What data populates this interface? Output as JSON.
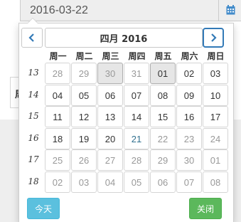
{
  "date_field": {
    "value": "2016-03-22"
  },
  "background": {
    "fragment_text": "周"
  },
  "picker": {
    "title": "四月 2016",
    "weekdays": [
      "周一",
      "周二",
      "周三",
      "周四",
      "周五",
      "周六",
      "周日"
    ],
    "weeks": [
      {
        "num": "13",
        "days": [
          {
            "t": "28",
            "s": "muted"
          },
          {
            "t": "29",
            "s": "muted"
          },
          {
            "t": "30",
            "s": "muted-sel"
          },
          {
            "t": "31",
            "s": "muted"
          },
          {
            "t": "01",
            "s": "sel"
          },
          {
            "t": "02",
            "s": ""
          },
          {
            "t": "03",
            "s": ""
          }
        ]
      },
      {
        "num": "14",
        "days": [
          {
            "t": "04",
            "s": ""
          },
          {
            "t": "05",
            "s": ""
          },
          {
            "t": "06",
            "s": ""
          },
          {
            "t": "07",
            "s": ""
          },
          {
            "t": "08",
            "s": ""
          },
          {
            "t": "09",
            "s": ""
          },
          {
            "t": "10",
            "s": ""
          }
        ]
      },
      {
        "num": "15",
        "days": [
          {
            "t": "11",
            "s": ""
          },
          {
            "t": "12",
            "s": ""
          },
          {
            "t": "13",
            "s": ""
          },
          {
            "t": "14",
            "s": ""
          },
          {
            "t": "15",
            "s": ""
          },
          {
            "t": "16",
            "s": ""
          },
          {
            "t": "17",
            "s": ""
          }
        ]
      },
      {
        "num": "16",
        "days": [
          {
            "t": "18",
            "s": ""
          },
          {
            "t": "19",
            "s": ""
          },
          {
            "t": "20",
            "s": ""
          },
          {
            "t": "21",
            "s": "info"
          },
          {
            "t": "22",
            "s": "muted"
          },
          {
            "t": "23",
            "s": "muted"
          },
          {
            "t": "24",
            "s": "muted"
          }
        ]
      },
      {
        "num": "17",
        "days": [
          {
            "t": "25",
            "s": "muted"
          },
          {
            "t": "26",
            "s": "muted"
          },
          {
            "t": "27",
            "s": "muted"
          },
          {
            "t": "28",
            "s": "muted"
          },
          {
            "t": "29",
            "s": "muted"
          },
          {
            "t": "30",
            "s": "muted"
          },
          {
            "t": "01",
            "s": "muted"
          }
        ]
      },
      {
        "num": "18",
        "days": [
          {
            "t": "02",
            "s": "muted"
          },
          {
            "t": "03",
            "s": "muted"
          },
          {
            "t": "04",
            "s": "muted"
          },
          {
            "t": "05",
            "s": "muted"
          },
          {
            "t": "06",
            "s": "muted"
          },
          {
            "t": "07",
            "s": "muted"
          },
          {
            "t": "08",
            "s": "muted"
          }
        ]
      }
    ],
    "today_label": "今天",
    "close_label": "关闭"
  },
  "icons": {
    "calendar": "calendar-icon",
    "prev": "chevron-left-icon",
    "next": "chevron-right-icon"
  },
  "colors": {
    "accent": "#337ab7",
    "today_button": "#5bc0de",
    "close_button": "#5cb85c",
    "calendar_icon": "#428bca"
  }
}
